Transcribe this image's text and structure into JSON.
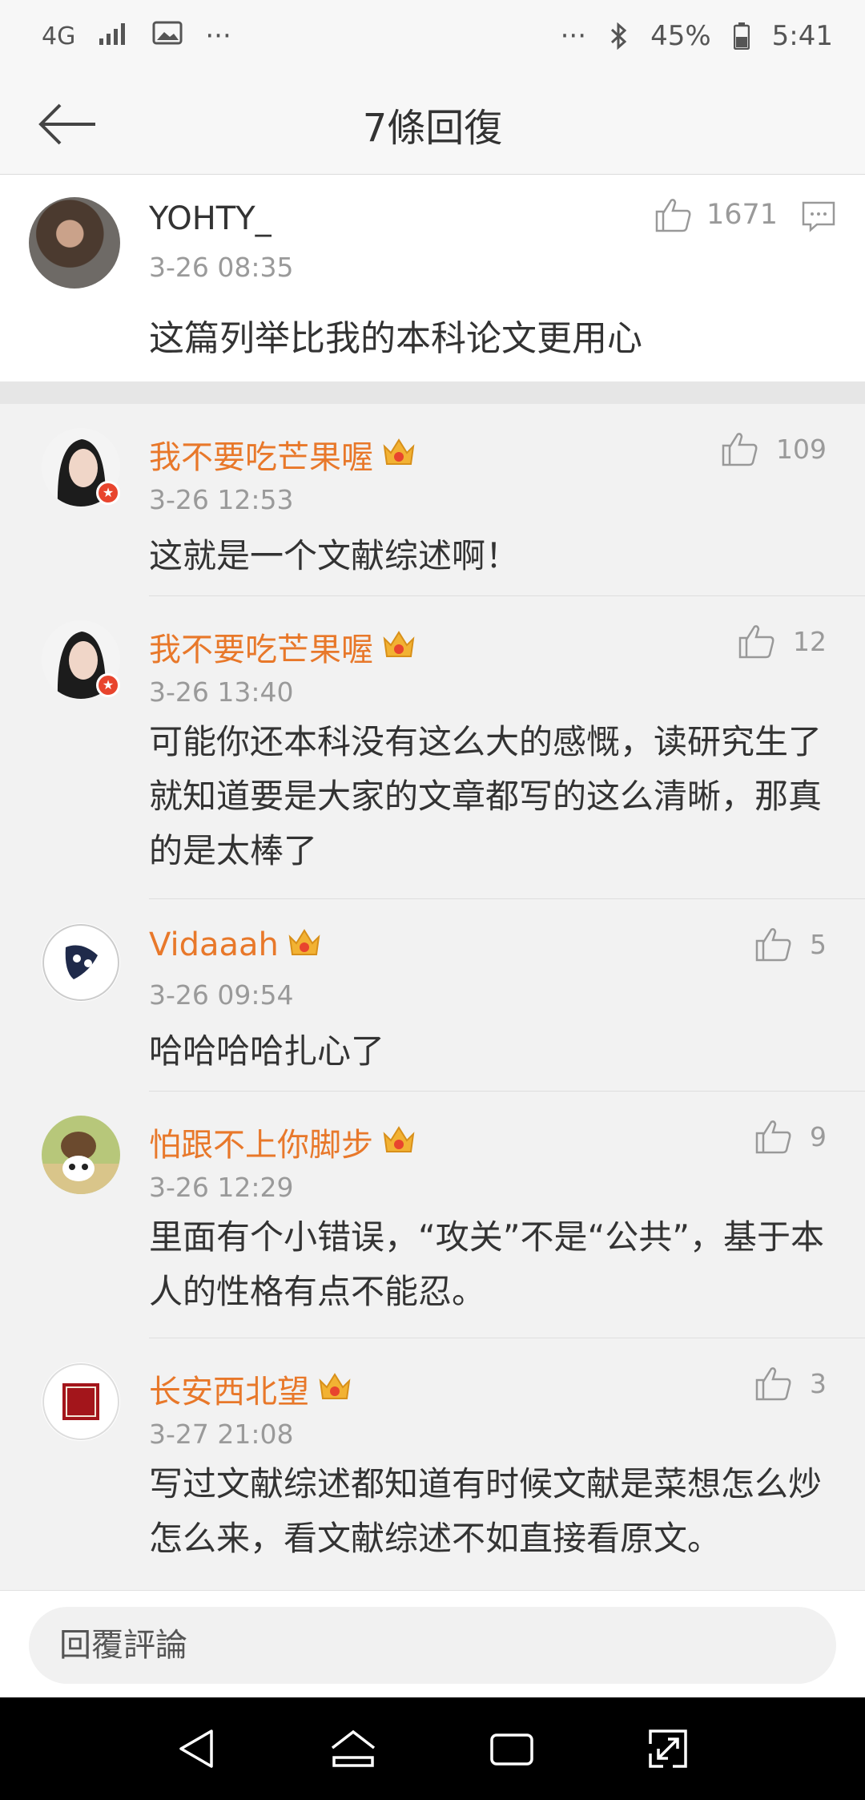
{
  "status_bar": {
    "network": "4G",
    "more_left": "···",
    "more_right": "···",
    "battery": "45%",
    "time": "5:41"
  },
  "header": {
    "title": "7條回復"
  },
  "root_comment": {
    "user": "YOHTY_",
    "time": "3-26 08:35",
    "text": "这篇列举比我的本科论文更用心",
    "likes": "1671"
  },
  "replies": [
    {
      "user": "我不要吃芒果喔",
      "time": "3-26 12:53",
      "likes": "109",
      "text": "这就是一个文献综述啊！"
    },
    {
      "user": "我不要吃芒果喔",
      "time": "3-26 13:40",
      "likes": "12",
      "text": "可能你还本科没有这么大的感慨，读研究生了就知道要是大家的文章都写的这么清晰，那真的是太棒了"
    },
    {
      "user": "Vidaaah",
      "time": "3-26 09:54",
      "likes": "5",
      "text": "哈哈哈哈扎心了"
    },
    {
      "user": "怕跟不上你脚步",
      "time": "3-26 12:29",
      "likes": "9",
      "text": "里面有个小错误，“攻关”不是“公共”，基于本人的性格有点不能忍。"
    },
    {
      "user": "长安西北望",
      "time": "3-27 21:08",
      "likes": "3",
      "text": "写过文献综述都知道有时候文献是菜想怎么炒怎么来，看文献综述不如直接看原文。"
    }
  ],
  "input": {
    "placeholder": "回覆評論"
  },
  "colors": {
    "username": "#e8782a",
    "accent_badge": "#e8452e",
    "crown": "#f2b233"
  }
}
